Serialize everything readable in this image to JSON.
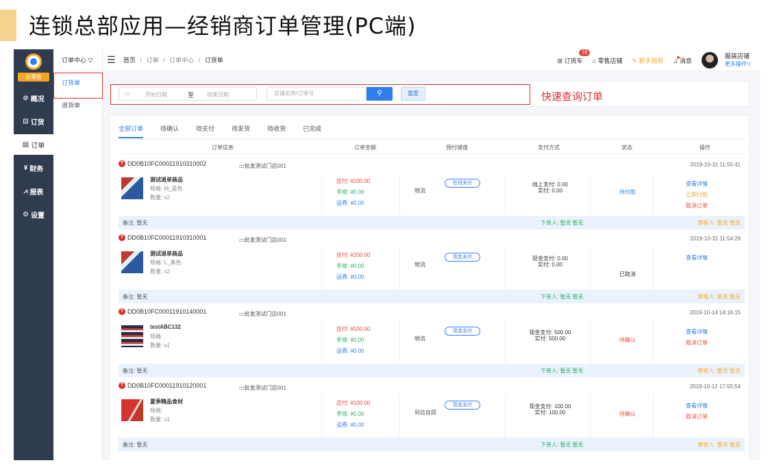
{
  "slide": {
    "title": "连锁总部应用—经销商订单管理(PC端)"
  },
  "annotation": "快速查询订单",
  "sidebar": {
    "brand": "云零售",
    "items": [
      {
        "label": "概况",
        "icon": "dashboard-icon"
      },
      {
        "label": "订货",
        "icon": "order-goods-icon"
      },
      {
        "label": "订单",
        "icon": "order-doc-icon"
      },
      {
        "label": "财务",
        "icon": "finance-icon"
      },
      {
        "label": "报表",
        "icon": "report-icon"
      },
      {
        "label": "设置",
        "icon": "settings-icon"
      }
    ]
  },
  "subnav": {
    "header": "订单中心 ▽",
    "items": [
      "订货单",
      "退货单"
    ]
  },
  "topbar": {
    "breadcrumbs": [
      "首页",
      "订单",
      "订单中心",
      "订货单"
    ],
    "cart_label": "订货车",
    "cart_count": "15",
    "retail_label": "零售店铺",
    "guide_label": "新手指导",
    "msg_label": "消息",
    "store_name": "服装店铺",
    "more_ops": "更多操作▽"
  },
  "search": {
    "start_placeholder": "开始日期",
    "to": "至",
    "end_placeholder": "结束日期",
    "keyword_placeholder": "店铺名称/订单号",
    "reset_label": "重置"
  },
  "tabs": [
    "全部订单",
    "待确认",
    "待支付",
    "待发货",
    "待收货",
    "已完成"
  ],
  "columns": [
    "订单信息",
    "订单金额",
    "预付储值",
    "支付方式",
    "状态",
    "操作"
  ],
  "orders": [
    {
      "no": "DD0B10FC00011910310002",
      "shop": "批发测试门店001",
      "time": "2019-10-31 11:55:41",
      "product": "测试退单商品",
      "spec": "规格:   M_蓝色",
      "qty": "数量:  x2",
      "pay": "应付:  ¥200.00",
      "fee": "手续:  ¥0.00",
      "ship": "运费:  ¥0.00",
      "delivery": "物流",
      "paytag": "在线支付",
      "method1": "线上支付:  0.00",
      "method2": "实付:  0.00",
      "status": "待付款",
      "status_color": "#2f80ed",
      "ops": [
        [
          "查看详情",
          "blue"
        ],
        [
          "立即付款",
          "orange"
        ],
        [
          "取消订单",
          "red"
        ]
      ],
      "remark": "备注:  暂无",
      "placer": "下单人:  暂无  暂无",
      "auditor": "审核人:  暂无  暂无",
      "thumb": "flag"
    },
    {
      "no": "DD0B10FC00011910310001",
      "shop": "批发测试门店001",
      "time": "2019-10-31 11:54:29",
      "product": "测试退单商品",
      "spec": "规格:   L_黑色",
      "qty": "数量:  x2",
      "pay": "应付:  ¥200.00",
      "fee": "手续:  ¥0.00",
      "ship": "运费:  ¥0.00",
      "delivery": "物流",
      "paytag": "现金支付",
      "method1": "现金支付:  0.00",
      "method2": "实付:  0.00",
      "status": "已取消",
      "status_color": "#333333",
      "ops": [
        [
          "查看详情",
          "blue"
        ]
      ],
      "remark": "备注:  暂无",
      "placer": "下单人:  暂无  暂无",
      "auditor": "审核人:  暂无  暂无",
      "thumb": "flag"
    },
    {
      "no": "DD0B10FC00011910140001",
      "shop": "批发测试门店001",
      "time": "2019-10-14 14:16:15",
      "product": "testABC132",
      "spec": "规格:",
      "qty": "数量:  x1",
      "pay": "应付:  ¥500.00",
      "fee": "手续:  ¥0.00",
      "ship": "运费:  ¥0.00",
      "delivery": "物流",
      "paytag": "现金支付",
      "method1": "现金支付:  500.00",
      "method2": "实付:  500.00",
      "status": "待确认",
      "status_color": "#e74c3c",
      "ops": [
        [
          "查看详情",
          "blue"
        ],
        [
          "取消订单",
          "red"
        ]
      ],
      "remark": "备注:  暂无",
      "placer": "下单人:  暂无  暂无",
      "auditor": "审核人:  暂无  暂无",
      "thumb": "stripes"
    },
    {
      "no": "DD0B10FC00011910120001",
      "shop": "批发测试门店001",
      "time": "2019-10-12 17:55:54",
      "product": "夏季精品食材",
      "spec": "规格:",
      "qty": "数量:  x1",
      "pay": "应付:  ¥100.00",
      "fee": "手续:  ¥0.00",
      "ship": "运费:  ¥0.00",
      "delivery": "到店自提",
      "paytag": "现金支付",
      "method1": "现金支付:  100.00",
      "method2": "实付:  100.00",
      "status": "待确认",
      "status_color": "#e74c3c",
      "ops": [
        [
          "查看详情",
          "blue"
        ],
        [
          "取消订单",
          "red"
        ]
      ],
      "remark": "备注:  暂无",
      "placer": "下单人:  暂无  暂无",
      "auditor": "审核人:  暂无  暂无",
      "thumb": "redflag"
    }
  ]
}
